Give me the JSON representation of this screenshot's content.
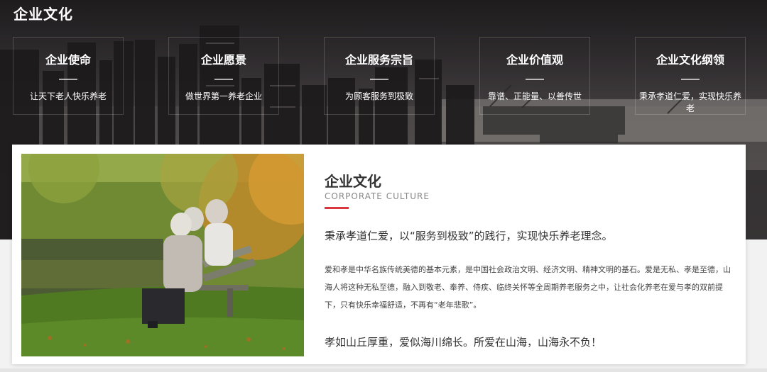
{
  "page": {
    "title": "企业文化"
  },
  "values": [
    {
      "title": "企业使命",
      "text": "让天下老人快乐养老"
    },
    {
      "title": "企业愿景",
      "text": "做世界第一养老企业"
    },
    {
      "title": "企业服务宗旨",
      "text": "为顾客服务到极致"
    },
    {
      "title": "企业价值观",
      "text": "靠谱、正能量、以善传世"
    },
    {
      "title": "企业文化纲领",
      "text": "秉承孝道仁爱，实现快乐养老"
    }
  ],
  "culture": {
    "title": "企业文化",
    "subtitle": "CORPORATE CULTURE",
    "lead": "秉承孝道仁爱，以“服务到极致”的践行，实现快乐养老理念。",
    "body": "爱和孝是中华名族传统美德的基本元素，是中国社会政治文明、经济文明、精神文明的基石。爱是无私、孝是至德，山海人将这种无私至德，融入到敬老、奉养、侍疾、临终关怀等全周期养老服务之中，让社会化养老在爱与孝的双前提下，只有快乐幸福舒适，不再有“老年悲歌”。",
    "closing": "孝如山丘厚重，爱似海川绵长。所爱在山海，山海永不负！"
  },
  "colors": {
    "accent": "#d9363e",
    "hero_overlay": "#3b3638",
    "card_bg": "#ffffff"
  }
}
